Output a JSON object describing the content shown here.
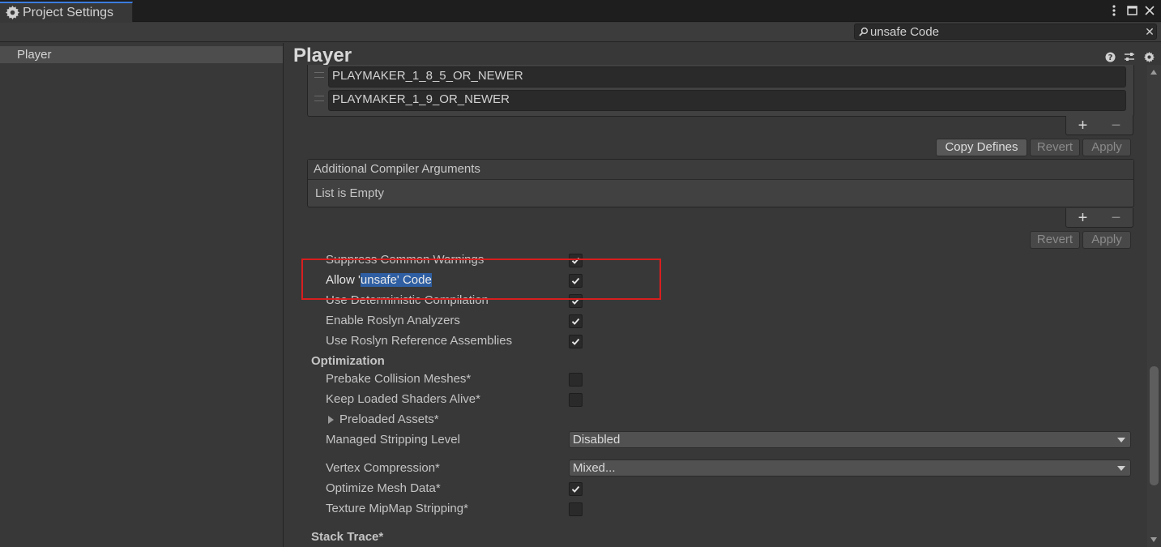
{
  "window": {
    "tab_title": "Project Settings"
  },
  "search": {
    "value": "unsafe Code"
  },
  "sidebar": {
    "items": [
      {
        "label": "Player"
      }
    ]
  },
  "main": {
    "title": "Player",
    "defines": [
      "PLAYMAKER_1_8_5_OR_NEWER",
      "PLAYMAKER_1_9_OR_NEWER"
    ],
    "defines_buttons": {
      "copy": "Copy Defines",
      "revert": "Revert",
      "apply": "Apply"
    },
    "compiler_args": {
      "header": "Additional Compiler Arguments",
      "empty": "List is Empty",
      "revert": "Revert",
      "apply": "Apply"
    },
    "script_props": [
      {
        "label": "Suppress Common Warnings",
        "checked": true
      },
      {
        "label_prefix": "Allow '",
        "label_highlight": "unsafe' Code",
        "checked": true
      },
      {
        "label": "Use Deterministic Compilation",
        "checked": true
      },
      {
        "label": "Enable Roslyn Analyzers",
        "checked": true
      },
      {
        "label": "Use Roslyn Reference Assemblies",
        "checked": true
      }
    ],
    "optimization": {
      "header": "Optimization",
      "prebake": {
        "label": "Prebake Collision Meshes*",
        "checked": false
      },
      "keep_shaders": {
        "label": "Keep Loaded Shaders Alive*",
        "checked": false
      },
      "preloaded": "Preloaded Assets*",
      "stripping": {
        "label": "Managed Stripping Level",
        "value": "Disabled"
      },
      "vertex": {
        "label": "Vertex Compression*",
        "value": "Mixed..."
      },
      "optimize_mesh": {
        "label": "Optimize Mesh Data*",
        "checked": true
      },
      "mipmap": {
        "label": "Texture MipMap Stripping*",
        "checked": false
      }
    },
    "stack_trace": "Stack Trace*"
  }
}
